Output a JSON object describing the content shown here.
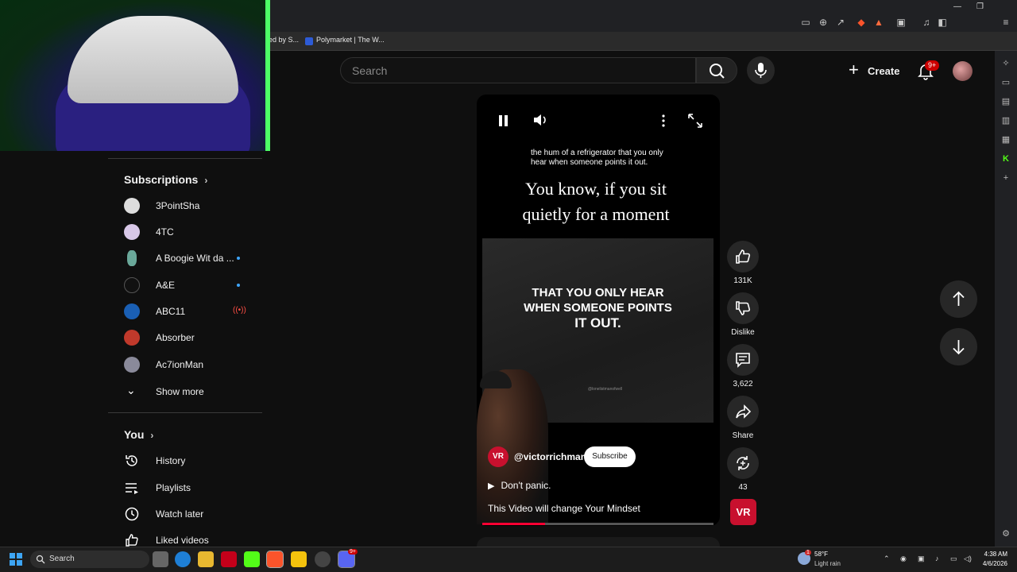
{
  "browser": {
    "bookmarks": [
      "ed by S...",
      "Polymarket | The W..."
    ]
  },
  "header": {
    "search_placeholder": "Search",
    "create_label": "Create",
    "notifications_badge": "9+"
  },
  "sidebar": {
    "subscriptions_title": "Subscriptions",
    "subscriptions": [
      {
        "name": "3PointSha",
        "indicator": "none"
      },
      {
        "name": "4TC",
        "indicator": "none"
      },
      {
        "name": "A Boogie Wit da ...",
        "indicator": "dot"
      },
      {
        "name": "A&E",
        "indicator": "dot"
      },
      {
        "name": "ABC11",
        "indicator": "live"
      },
      {
        "name": "Absorber",
        "indicator": "none"
      },
      {
        "name": "Ac7ionMan",
        "indicator": "none"
      }
    ],
    "show_more_label": "Show more",
    "you_title": "You",
    "you_items": [
      {
        "label": "History",
        "icon": "history-icon"
      },
      {
        "label": "Playlists",
        "icon": "playlists-icon"
      },
      {
        "label": "Watch later",
        "icon": "watch-later-icon"
      },
      {
        "label": "Liked videos",
        "icon": "liked-videos-icon"
      }
    ]
  },
  "short": {
    "caption_small": "the hum of a refrigerator that you only hear when someone points it out.",
    "caption_big": "You know, if you sit quietly for a moment",
    "frame_text_line1": "THAT YOU ONLY HEAR",
    "frame_text_line2": "WHEN SOMEONE POINTS",
    "frame_text_line3": "IT OUT.",
    "watermark": "@lonelistmanofwell",
    "channel_handle": "@victorrichman",
    "channel_avatar_text": "VR",
    "subscribe_label": "Subscribe",
    "audio_label": "Don't  panic.",
    "title": "This Video will change Your Mindset",
    "progress": 0.27
  },
  "actions": {
    "like_count": "131K",
    "dislike_label": "Dislike",
    "comment_count": "3,622",
    "share_label": "Share",
    "remix_count": "43",
    "sound_thumb_text": "VR"
  },
  "taskbar": {
    "search_label": "Search",
    "weather_temp": "58°F",
    "weather_desc": "Light rain",
    "weather_badge": "1",
    "time": "4:38 AM",
    "date": "4/6/2026",
    "discord_badge": "9+"
  },
  "colors": {
    "accent_red": "#ff0033",
    "bg": "#0f0f0f",
    "button_bg": "#272727"
  }
}
